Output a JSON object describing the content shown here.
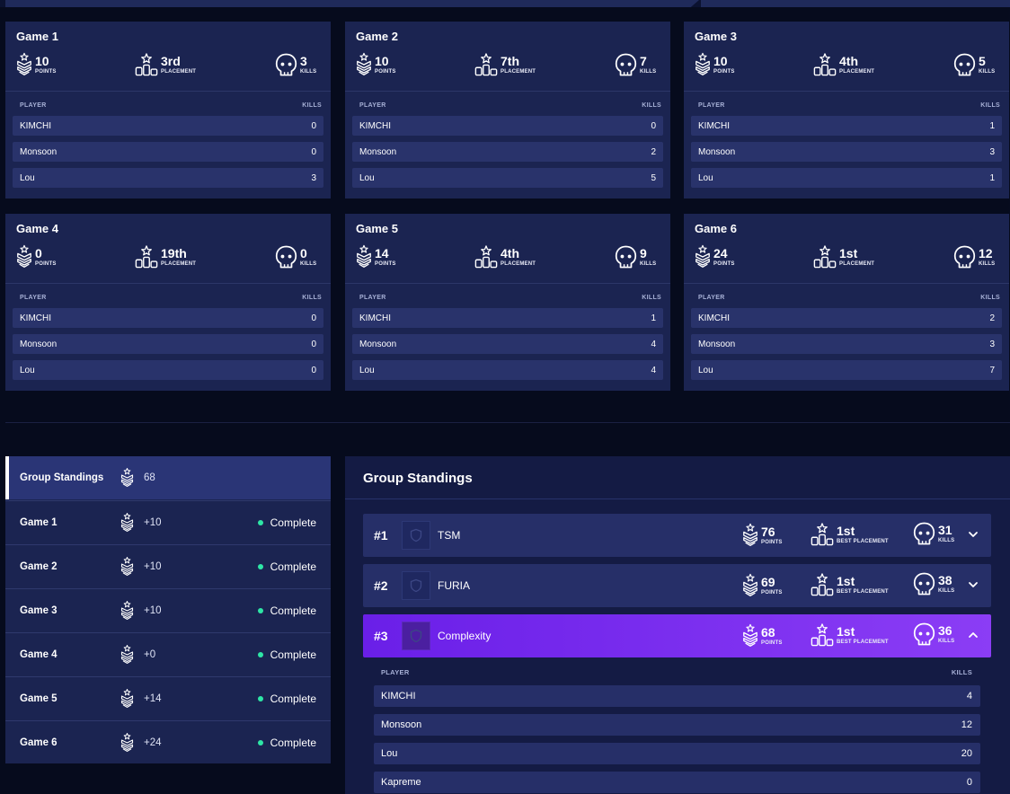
{
  "labels": {
    "points": "POINTS",
    "placement": "PLACEMENT",
    "best_placement": "BEST PLACEMENT",
    "kills": "KILLS",
    "player": "PLAYER",
    "kills_col": "KILLS"
  },
  "games": [
    {
      "title": "Game 1",
      "points": "10",
      "placement": "3rd",
      "kills": "3",
      "players": [
        {
          "name": "KIMCHI",
          "kills": "0"
        },
        {
          "name": "Monsoon",
          "kills": "0"
        },
        {
          "name": "Lou",
          "kills": "3"
        }
      ]
    },
    {
      "title": "Game 2",
      "points": "10",
      "placement": "7th",
      "kills": "7",
      "players": [
        {
          "name": "KIMCHI",
          "kills": "0"
        },
        {
          "name": "Monsoon",
          "kills": "2"
        },
        {
          "name": "Lou",
          "kills": "5"
        }
      ]
    },
    {
      "title": "Game 3",
      "points": "10",
      "placement": "4th",
      "kills": "5",
      "players": [
        {
          "name": "KIMCHI",
          "kills": "1"
        },
        {
          "name": "Monsoon",
          "kills": "3"
        },
        {
          "name": "Lou",
          "kills": "1"
        }
      ]
    },
    {
      "title": "Game 4",
      "points": "0",
      "placement": "19th",
      "kills": "0",
      "players": [
        {
          "name": "KIMCHI",
          "kills": "0"
        },
        {
          "name": "Monsoon",
          "kills": "0"
        },
        {
          "name": "Lou",
          "kills": "0"
        }
      ]
    },
    {
      "title": "Game 5",
      "points": "14",
      "placement": "4th",
      "kills": "9",
      "players": [
        {
          "name": "KIMCHI",
          "kills": "1"
        },
        {
          "name": "Monsoon",
          "kills": "4"
        },
        {
          "name": "Lou",
          "kills": "4"
        }
      ]
    },
    {
      "title": "Game 6",
      "points": "24",
      "placement": "1st",
      "kills": "12",
      "players": [
        {
          "name": "KIMCHI",
          "kills": "2"
        },
        {
          "name": "Monsoon",
          "kills": "3"
        },
        {
          "name": "Lou",
          "kills": "7"
        }
      ]
    }
  ],
  "nav": [
    {
      "label": "Group Standings",
      "score": "68",
      "status": "",
      "active": true
    },
    {
      "label": "Game 1",
      "score": "+10",
      "status": "Complete"
    },
    {
      "label": "Game 2",
      "score": "+10",
      "status": "Complete"
    },
    {
      "label": "Game 3",
      "score": "+10",
      "status": "Complete"
    },
    {
      "label": "Game 4",
      "score": "+0",
      "status": "Complete"
    },
    {
      "label": "Game 5",
      "score": "+14",
      "status": "Complete"
    },
    {
      "label": "Game 6",
      "score": "+24",
      "status": "Complete"
    }
  ],
  "standings": {
    "title": "Group Standings",
    "teams": [
      {
        "rank": "#1",
        "name": "TSM",
        "points": "76",
        "best_placement": "1st",
        "kills": "31",
        "expanded": false
      },
      {
        "rank": "#2",
        "name": "FURIA",
        "points": "69",
        "best_placement": "1st",
        "kills": "38",
        "expanded": false
      },
      {
        "rank": "#3",
        "name": "Complexity",
        "points": "68",
        "best_placement": "1st",
        "kills": "36",
        "expanded": true
      }
    ],
    "expanded_players": [
      {
        "name": "KIMCHI",
        "kills": "4"
      },
      {
        "name": "Monsoon",
        "kills": "12"
      },
      {
        "name": "Lou",
        "kills": "20"
      },
      {
        "name": "Kapreme",
        "kills": "0"
      }
    ]
  },
  "colors": {
    "background": "#060b1d",
    "card": "#1b2451",
    "row": "#29336b",
    "accent_purple": "#7b2ff0",
    "complete_dot": "#2ee6a6"
  }
}
